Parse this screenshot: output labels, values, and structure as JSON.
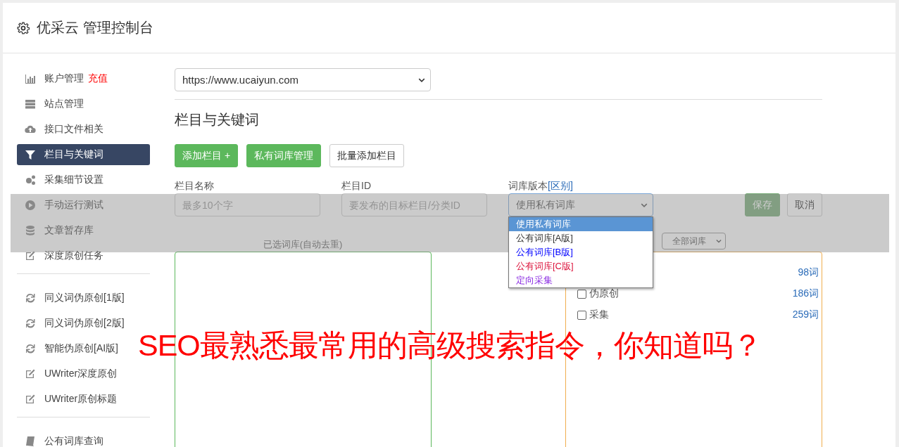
{
  "header": {
    "title": "优采云 管理控制台"
  },
  "sidebar": {
    "groups": [
      {
        "items": [
          {
            "label": "账户管理",
            "badge": "充值",
            "selected": false
          },
          {
            "label": "站点管理",
            "selected": false
          },
          {
            "label": "接口文件相关",
            "selected": false
          },
          {
            "label": "栏目与关键词",
            "selected": true
          },
          {
            "label": "采集细节设置",
            "selected": false
          },
          {
            "label": "手动运行测试",
            "selected": false
          },
          {
            "label": "文章暂存库",
            "selected": false
          },
          {
            "label": "深度原创任务",
            "selected": false
          }
        ]
      },
      {
        "items": [
          {
            "label": "同义词伪原创[1版]",
            "selected": false
          },
          {
            "label": "同义词伪原创[2版]",
            "selected": false
          },
          {
            "label": "智能伪原创[AI版]",
            "selected": false
          },
          {
            "label": "UWriter深度原创",
            "selected": false
          },
          {
            "label": "UWriter原创标题",
            "selected": false
          }
        ]
      },
      {
        "items": [
          {
            "label": "公有词库查询",
            "selected": false
          }
        ]
      }
    ]
  },
  "site_select": {
    "value": "https://www.ucaiyun.com"
  },
  "heading": "栏目与关键词",
  "actions": [
    {
      "label": "添加栏目 +",
      "kind": "primary"
    },
    {
      "label": "私有词库管理",
      "kind": "primary"
    },
    {
      "label": "批量添加栏目",
      "kind": "plain"
    }
  ],
  "form": {
    "name": {
      "label": "栏目名称",
      "placeholder": "最多10个字"
    },
    "id": {
      "label": "栏目ID",
      "placeholder": "要发布的目标栏目/分类ID"
    },
    "version": {
      "label": "词库版本",
      "link": "[区别]",
      "value": "使用私有词库",
      "expanded": true,
      "options": [
        {
          "label": "使用私有词库",
          "selected": true
        },
        {
          "label": "公有词库[A版]",
          "selected": false
        },
        {
          "label": "公有词库[B版]",
          "selected": false,
          "color": "#0000ff"
        },
        {
          "label": "公有词库[C版]",
          "selected": false,
          "color": "#dc143c"
        },
        {
          "label": "定向采集",
          "selected": false,
          "color": "#8a2be2"
        }
      ]
    },
    "save": "保存",
    "cancel": "取消"
  },
  "selected_box": {
    "title": "已选词库(自动去重)"
  },
  "library_filter": {
    "value": "全部词库"
  },
  "library_rows": [
    {
      "count": "98词"
    },
    {
      "label": "伪原创",
      "checked": false,
      "count": "186词"
    },
    {
      "label": "采集",
      "checked": false,
      "count": "259词"
    }
  ],
  "overlay": {
    "headline": "SEO最熟悉最常用的高级搜索指令，你知道吗？"
  }
}
